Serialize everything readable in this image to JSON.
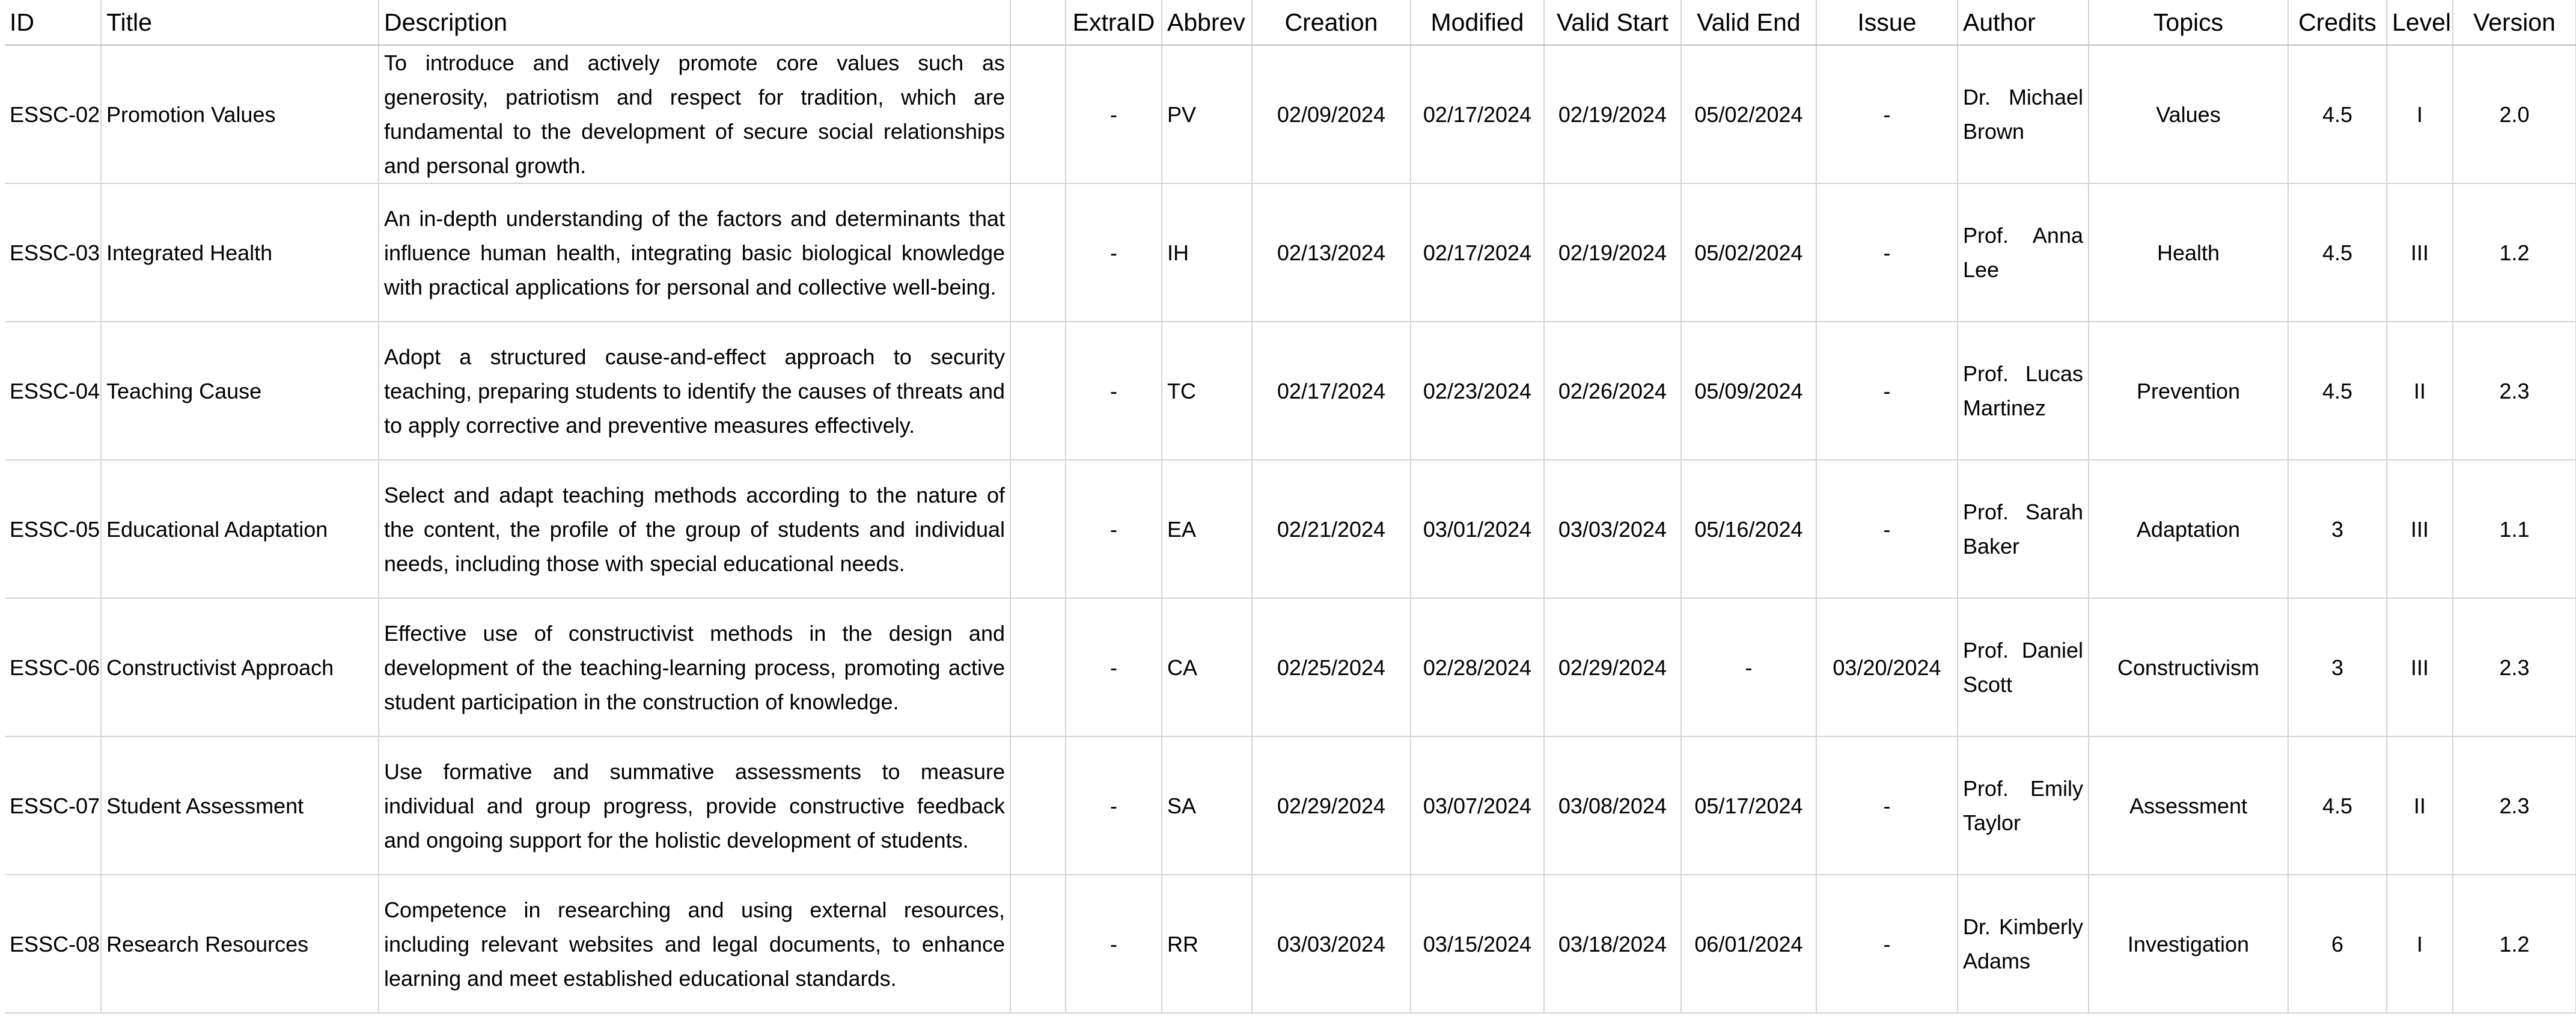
{
  "columns": [
    "ID",
    "Title",
    "Description",
    "",
    "ExtraID",
    "Abbrev",
    "Creation",
    "Modified",
    "Valid Start",
    "Valid End",
    "Issue",
    "Author",
    "Topics",
    "Credits",
    "Level",
    "Version"
  ],
  "rows": [
    {
      "id": "ESSC-02",
      "title": "Promotion Values",
      "description": "To introduce and actively promote core values such as generosity, patriotism and respect for tradition, which are fundamental to the development of secure social relationships and personal growth.",
      "blank": "",
      "extra_id": "-",
      "abbrev": "PV",
      "creation": "02/09/2024",
      "modified": "02/17/2024",
      "valid_start": "02/19/2024",
      "valid_end": "05/02/2024",
      "issue": "-",
      "author": "Dr. Michael Brown",
      "topics": "Values",
      "credits": "4.5",
      "level": "I",
      "version": "2.0"
    },
    {
      "id": "ESSC-03",
      "title": "Integrated Health",
      "description": "An in-depth understanding of the factors and determinants that influence human health, integrating basic biological knowledge with practical applications for personal and collective well-being.",
      "blank": "",
      "extra_id": "-",
      "abbrev": "IH",
      "creation": "02/13/2024",
      "modified": "02/17/2024",
      "valid_start": "02/19/2024",
      "valid_end": "05/02/2024",
      "issue": "-",
      "author": "Prof. Anna Lee",
      "topics": "Health",
      "credits": "4.5",
      "level": "III",
      "version": "1.2"
    },
    {
      "id": "ESSC-04",
      "title": "Teaching Cause",
      "description": "Adopt a structured cause-and-effect approach to security teaching, preparing students to identify the causes of threats and to apply corrective and preventive measures effectively.",
      "blank": "",
      "extra_id": "-",
      "abbrev": "TC",
      "creation": "02/17/2024",
      "modified": "02/23/2024",
      "valid_start": "02/26/2024",
      "valid_end": "05/09/2024",
      "issue": "-",
      "author": "Prof. Lucas Martinez",
      "topics": "Prevention",
      "credits": "4.5",
      "level": "II",
      "version": "2.3"
    },
    {
      "id": "ESSC-05",
      "title": "Educational Adaptation",
      "description": "Select and adapt teaching methods according to the nature of the content, the profile of the group of students and individual needs, including those with special educational needs.",
      "blank": "",
      "extra_id": "-",
      "abbrev": "EA",
      "creation": "02/21/2024",
      "modified": "03/01/2024",
      "valid_start": "03/03/2024",
      "valid_end": "05/16/2024",
      "issue": "-",
      "author": "Prof. Sarah Baker",
      "topics": "Adaptation",
      "credits": "3",
      "level": "III",
      "version": "1.1"
    },
    {
      "id": "ESSC-06",
      "title": "Constructivist Approach",
      "description": "Effective use of constructivist methods in the design and development of the teaching-learning process, promoting active student participation in the construction of knowledge.",
      "blank": "",
      "extra_id": "-",
      "abbrev": "CA",
      "creation": "02/25/2024",
      "modified": "02/28/2024",
      "valid_start": "02/29/2024",
      "valid_end": "-",
      "issue": "03/20/2024",
      "author": "Prof. Daniel Scott",
      "topics": "Constructivism",
      "credits": "3",
      "level": "III",
      "version": "2.3"
    },
    {
      "id": "ESSC-07",
      "title": "Student Assessment",
      "description": "Use formative and summative assessments to measure individual and group progress, provide constructive feedback and ongoing support for the holistic development of students.",
      "blank": "",
      "extra_id": "-",
      "abbrev": "SA",
      "creation": "02/29/2024",
      "modified": "03/07/2024",
      "valid_start": "03/08/2024",
      "valid_end": "05/17/2024",
      "issue": "-",
      "author": "Prof. Emily Taylor",
      "topics": "Assessment",
      "credits": "4.5",
      "level": "II",
      "version": "2.3"
    },
    {
      "id": "ESSC-08",
      "title": "Research Resources",
      "description": "Competence in researching and using external resources, including relevant websites and legal documents, to enhance learning and meet established educational standards.",
      "blank": "",
      "extra_id": "-",
      "abbrev": "RR",
      "creation": "03/03/2024",
      "modified": "03/15/2024",
      "valid_start": "03/18/2024",
      "valid_end": "06/01/2024",
      "issue": "-",
      "author": "Dr. Kimberly Adams",
      "topics": "Investigation",
      "credits": "6",
      "level": "I",
      "version": "1.2"
    }
  ]
}
